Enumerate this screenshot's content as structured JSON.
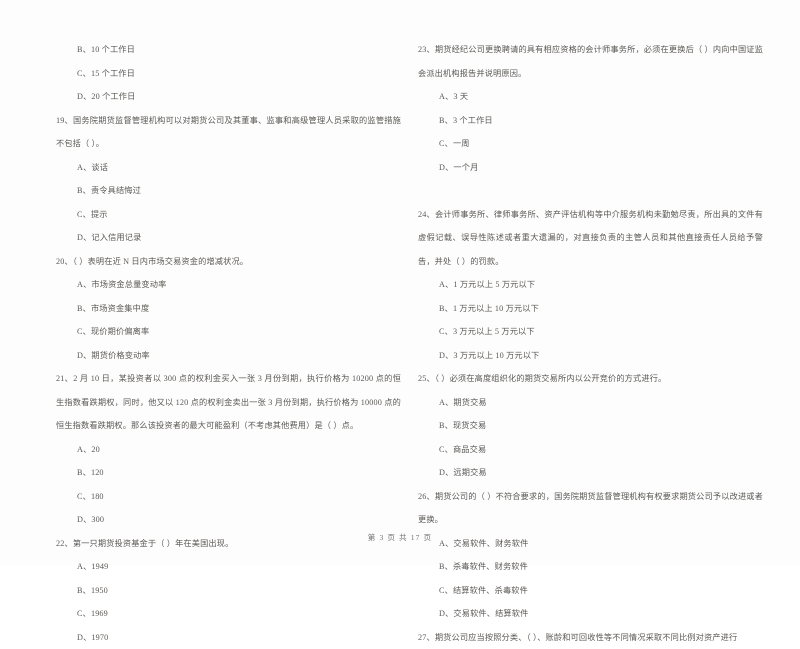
{
  "document": {
    "page_label": "第 3 页  共 17 页",
    "page_number": 3,
    "total_pages": 17
  },
  "left_column": [
    {
      "id": "q18-options-continued",
      "stem": null,
      "options": [
        "B、10 个工作日",
        "C、15 个工作日",
        "D、20 个工作日"
      ]
    },
    {
      "id": "q19",
      "stem": "19、国务院期货监督管理机构可以对期货公司及其董事、监事和高级管理人员采取的监管措施不包括（      ）。",
      "options": [
        "A、谈话",
        "B、责令具结悔过",
        "C、提示",
        "D、记入信用记录"
      ]
    },
    {
      "id": "q20",
      "stem": "20、（      ）表明在近 N 日内市场交易资金的增减状况。",
      "options": [
        "A、市场资金总量变动率",
        "B、市场资金集中度",
        "C、现价期价偏离率",
        "D、期货价格变动率"
      ]
    },
    {
      "id": "q21",
      "stem": "21、2 月 10 日，某投资者以 300 点的权利金买入一张 3 月份到期，执行价格为 10200 点的恒生指数看跌期权，同时，他又以 120 点的权利金卖出一张 3 月份到期，执行价格为 10000 点的恒生指数看跌期权。那么该投资者的最大可能盈利（不考虑其他费用）是（      ）点。",
      "options": [
        "A、20",
        "B、120",
        "C、180",
        "D、300"
      ]
    },
    {
      "id": "q22",
      "stem": "22、第一只期货投资基金于（      ）年在美国出现。",
      "options": [
        "A、1949",
        "B、1950",
        "C、1969",
        "D、1970"
      ]
    }
  ],
  "right_column": [
    {
      "id": "q23",
      "stem": "23、期货经纪公司更换聘请的具有相应资格的会计师事务所，必须在更换后（      ）内向中国证监会派出机构报告并说明原因。",
      "options": [
        "A、3 天",
        "B、3 个工作日",
        "C、一周",
        "D、一个月"
      ]
    },
    {
      "id": "q24",
      "stem": "24、会计师事务所、律师事务所、资产评估机构等中介服务机构未勤勉尽责，所出具的文件有虚假记载、误导性陈述或者重大遗漏的，对直接负责的主管人员和其他直接责任人员给予警告，并处（      ）的罚款。",
      "options": [
        "A、1 万元以上 5 万元以下",
        "B、1 万元以上 10 万元以下",
        "C、3 万元以上 5 万元以下",
        "D、3 万元以上 10 万元以下"
      ]
    },
    {
      "id": "q25",
      "stem": "25、（      ）必须在高度组织化的期货交易所内以公开竞价的方式进行。",
      "options": [
        "A、期货交易",
        "B、现货交易",
        "C、商品交易",
        "D、远期交易"
      ]
    },
    {
      "id": "q26",
      "stem": "26、期货公司的（      ）不符合要求的，国务院期货监督管理机构有权要求期货公司予以改进或者更换。",
      "options": [
        "A、交易软件、财务软件",
        "B、杀毒软件、财务软件",
        "C、结算软件、杀毒软件",
        "D、交易软件、结算软件"
      ]
    },
    {
      "id": "q27",
      "stem": "27、期货公司应当按照分类、（      ）、账龄和可回收性等不同情况采取不同比例对资产进行",
      "options": []
    }
  ]
}
